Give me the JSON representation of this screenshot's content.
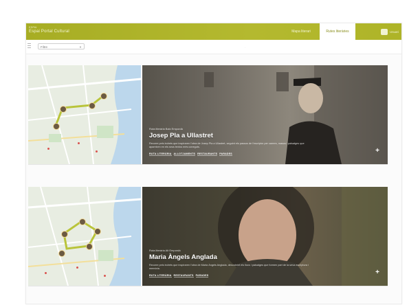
{
  "header": {
    "brand_small": "ESPAI",
    "brand_main": "Espai Portal Cultural",
    "nav": [
      "Mapa literari",
      "Rutes literàries"
    ],
    "active_tab": "Rutes literàries",
    "user_label": "Usuari"
  },
  "toolbar": {
    "select_value": "Filtre"
  },
  "cards": [
    {
      "kicker": "Ruta literària Baix Empordà",
      "title": "Josep Pla a Ullastret",
      "description": "Recorre pels indrets que inspiraren l'obra de Josep Pla a Ullastret, seguint els passos de l'escriptor per carrers, masos i paisatges que apareixen en els seus textos més coneguts.",
      "tags": [
        "RUTA LITERÀRIA",
        "ALLOTJAMENTS",
        "RESTAURANTS",
        "PARADES"
      ],
      "plus": "+"
    },
    {
      "kicker": "Ruta literària Alt Empordà",
      "title": "Maria Àngels Anglada",
      "description": "Recorre pels indrets que inspiraren l'obra de Maria Àngels Anglada, descobrint els llocs i paisatges que formen part de la seva escriptura i memòria.",
      "tags": [
        "RUTA LITERÀRIA",
        "RESTAURANTS",
        "PARADES"
      ],
      "plus": "+"
    }
  ],
  "colors": {
    "accent": "#a7ad24",
    "route": "#b9c43a",
    "pin": "#6b5a43"
  }
}
